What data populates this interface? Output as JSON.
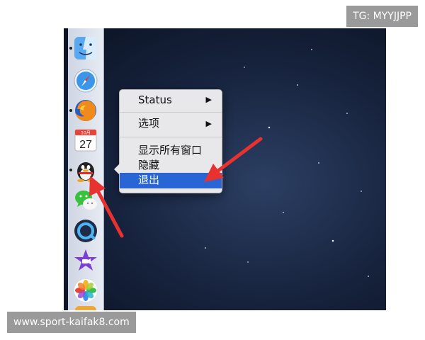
{
  "watermarks": {
    "top_right": "TG: MYYJJPP",
    "bottom_left": "www.sport-kaifak8.com"
  },
  "dock": {
    "items": [
      {
        "name": "finder",
        "running": true
      },
      {
        "name": "safari",
        "running": false
      },
      {
        "name": "firefox",
        "running": true
      },
      {
        "name": "calendar",
        "running": false,
        "month": "10月",
        "day": "27"
      },
      {
        "name": "qq",
        "running": true
      },
      {
        "name": "wechat",
        "running": false
      },
      {
        "name": "quicktime",
        "running": false
      },
      {
        "name": "imovie",
        "running": false
      },
      {
        "name": "photos",
        "running": false
      }
    ]
  },
  "context_menu": {
    "status": "Status",
    "options": "选项",
    "show_all_windows": "显示所有窗口",
    "hide": "隐藏",
    "quit": "退出",
    "submenu_arrow": "▶"
  },
  "colors": {
    "highlight": "#2a65d6",
    "annotation_arrow": "#e8322f"
  }
}
